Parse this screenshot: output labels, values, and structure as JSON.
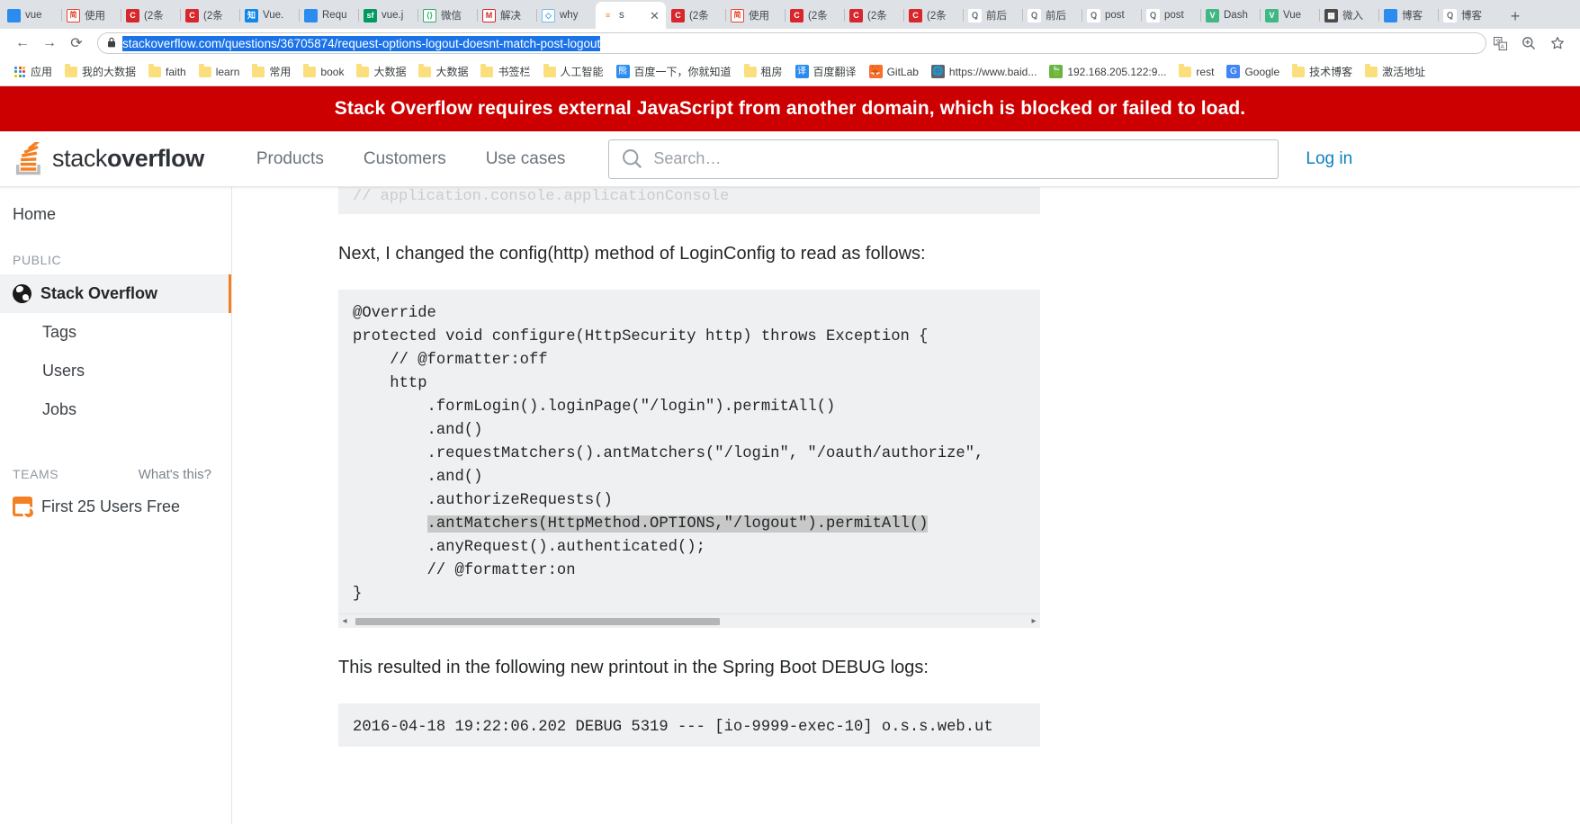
{
  "browser": {
    "tabs": [
      {
        "title": "vue ",
        "icon": "baidu-favicon",
        "glyph": "",
        "cls": "fav-baidu",
        "active": false
      },
      {
        "title": "使用",
        "icon": "jianshu-favicon",
        "glyph": "简",
        "cls": "fav-jian",
        "active": false
      },
      {
        "title": "(2条",
        "icon": "csdn-favicon",
        "glyph": "C",
        "cls": "fav-csdn",
        "active": false
      },
      {
        "title": "(2条",
        "icon": "csdn-favicon",
        "glyph": "C",
        "cls": "fav-csdn",
        "active": false
      },
      {
        "title": "Vue.",
        "icon": "zhihu-favicon",
        "glyph": "知",
        "cls": "fav-zhihu",
        "active": false
      },
      {
        "title": "Requ",
        "icon": "baidu-favicon",
        "glyph": "",
        "cls": "fav-baidu",
        "active": false
      },
      {
        "title": "vue.j",
        "icon": "segmentfault-favicon",
        "glyph": "sf",
        "cls": "fav-sf",
        "active": false
      },
      {
        "title": "微信",
        "icon": "wechat-favicon",
        "glyph": "⟨⟩",
        "cls": "fav-wechat",
        "active": false
      },
      {
        "title": "解决",
        "icon": "juejin-favicon",
        "glyph": "M",
        "cls": "fav-jue",
        "active": false
      },
      {
        "title": "why",
        "icon": "cloud-favicon",
        "glyph": "◇",
        "cls": "fav-why",
        "active": false
      },
      {
        "title": "s",
        "icon": "stackoverflow-favicon",
        "glyph": "≡",
        "cls": "fav-so",
        "active": true
      },
      {
        "title": "(2条",
        "icon": "csdn-favicon",
        "glyph": "C",
        "cls": "fav-csdn",
        "active": false
      },
      {
        "title": "使用",
        "icon": "jianshu-favicon",
        "glyph": "简",
        "cls": "fav-jian",
        "active": false
      },
      {
        "title": "(2条",
        "icon": "csdn-favicon",
        "glyph": "C",
        "cls": "fav-csdn",
        "active": false
      },
      {
        "title": "(2条",
        "icon": "csdn-favicon",
        "glyph": "C",
        "cls": "fav-csdn",
        "active": false
      },
      {
        "title": "(2条",
        "icon": "csdn-favicon",
        "glyph": "C",
        "cls": "fav-csdn",
        "active": false
      },
      {
        "title": "前后",
        "icon": "qianhou-favicon",
        "glyph": "Ꝗ",
        "cls": "fav-qh",
        "active": false
      },
      {
        "title": "前后",
        "icon": "qianhou-favicon",
        "glyph": "Ꝗ",
        "cls": "fav-qh",
        "active": false
      },
      {
        "title": "post",
        "icon": "qianhou-favicon",
        "glyph": "Ꝗ",
        "cls": "fav-qh",
        "active": false
      },
      {
        "title": "post",
        "icon": "qianhou-favicon",
        "glyph": "Ꝗ",
        "cls": "fav-qh",
        "active": false
      },
      {
        "title": "Dash",
        "icon": "vue-favicon",
        "glyph": "V",
        "cls": "fav-vue",
        "active": false
      },
      {
        "title": "Vue",
        "icon": "vue-favicon",
        "glyph": "V",
        "cls": "fav-vue",
        "active": false
      },
      {
        "title": "微入",
        "icon": "qrcode-favicon",
        "glyph": "▦",
        "cls": "fav-qr",
        "active": false
      },
      {
        "title": "博客",
        "icon": "baidu-favicon",
        "glyph": "",
        "cls": "fav-baidu",
        "active": false
      },
      {
        "title": "博客",
        "icon": "qianhou-favicon",
        "glyph": "Ꝗ",
        "cls": "fav-qh",
        "active": false
      }
    ],
    "new_tab_label": "+",
    "nav": {
      "back": "←",
      "forward": "→",
      "reload": "⟳",
      "lock": "🔒",
      "url": "stackoverflow.com/questions/36705874/request-options-logout-doesnt-match-post-logout",
      "translate": "translate-icon",
      "zoom": "⊕",
      "bookmark_star": "☆"
    },
    "bookmarks": [
      {
        "label": "应用",
        "type": "apps"
      },
      {
        "label": "我的大数据",
        "type": "folder"
      },
      {
        "label": "faith",
        "type": "folder"
      },
      {
        "label": "learn",
        "type": "folder"
      },
      {
        "label": "常用",
        "type": "folder"
      },
      {
        "label": "book",
        "type": "folder"
      },
      {
        "label": "大数据",
        "type": "folder"
      },
      {
        "label": "大数据",
        "type": "folder"
      },
      {
        "label": "书签栏",
        "type": "folder"
      },
      {
        "label": "人工智能",
        "type": "folder"
      },
      {
        "label": "百度一下，你就知道",
        "type": "site",
        "glyph": "熊",
        "color": "#2b8cf0"
      },
      {
        "label": "租房",
        "type": "folder"
      },
      {
        "label": "百度翻译",
        "type": "site",
        "glyph": "译",
        "color": "#2b8cf0"
      },
      {
        "label": "GitLab",
        "type": "site",
        "glyph": "🦊",
        "color": "#fc6d26"
      },
      {
        "label": "https://www.baid...",
        "type": "site",
        "glyph": "🌐",
        "color": "#5f6368"
      },
      {
        "label": "192.168.205.122:9...",
        "type": "site",
        "glyph": "🍃",
        "color": "#6db33f"
      },
      {
        "label": "rest",
        "type": "folder"
      },
      {
        "label": "Google",
        "type": "site",
        "glyph": "G",
        "color": "#4285f4"
      },
      {
        "label": "技术博客",
        "type": "folder"
      },
      {
        "label": "激活地址",
        "type": "folder"
      }
    ]
  },
  "page": {
    "warning_banner": "Stack Overflow requires external JavaScript from another domain, which is blocked or failed to load.",
    "header": {
      "logo_light": "stack",
      "logo_bold": "overflow",
      "nav": [
        "Products",
        "Customers",
        "Use cases"
      ],
      "search_placeholder": "Search…",
      "login_label": "Log in"
    },
    "sidebar": {
      "home": "Home",
      "public_heading": "PUBLIC",
      "active_item": "Stack Overflow",
      "sub_items": [
        "Tags",
        "Users",
        "Jobs"
      ],
      "teams_heading": "TEAMS",
      "whats_this": "What's this?",
      "teams_item": "First 25 Users Free"
    },
    "main": {
      "ghost_line": "// application.console.applicationConsole",
      "paragraph_1": "Next, I changed the config(http) method of LoginConfig to read as follows:",
      "code_before": "@Override\nprotected void configure(HttpSecurity http) throws Exception {\n    // @formatter:off\n    http\n        .formLogin().loginPage(\"/login\").permitAll()\n        .and()\n        .requestMatchers().antMatchers(\"/login\", \"/oauth/authorize\",\n        .and()\n        .authorizeRequests()\n        ",
      "code_highlight": ".antMatchers(HttpMethod.OPTIONS,\"/logout\").permitAll()",
      "code_after": "\n        .anyRequest().authenticated();\n        // @formatter:on\n}",
      "paragraph_2": "This resulted in the following new printout in the Spring Boot DEBUG logs:",
      "code_block_2": "2016-04-18 19:22:06.202 DEBUG 5319 --- [io-9999-exec-10] o.s.s.web.ut",
      "scroll_left_arrow": "◂",
      "scroll_right_arrow": "▸"
    },
    "colors": {
      "warning_bg": "#cc0000",
      "accent_orange": "#f48024",
      "link_blue": "#0c7fc4",
      "url_selection": "#1a73e8"
    }
  }
}
